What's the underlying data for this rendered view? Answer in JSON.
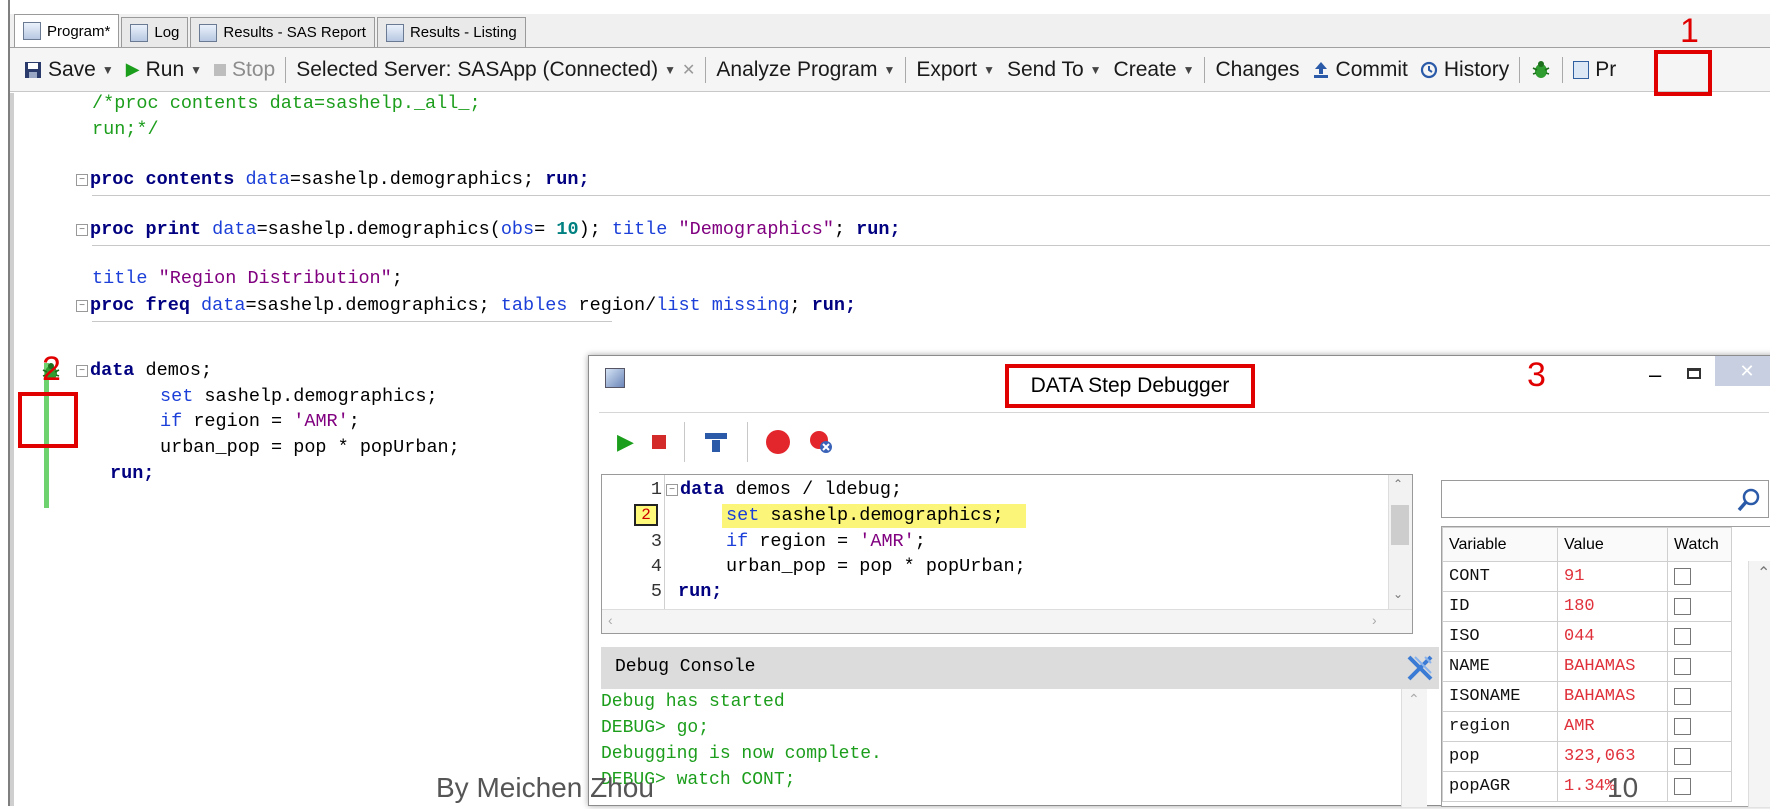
{
  "tabs": [
    {
      "label": "Program*",
      "active": true
    },
    {
      "label": "Log",
      "active": false
    },
    {
      "label": "Results - SAS Report",
      "active": false
    },
    {
      "label": "Results - Listing",
      "active": false
    }
  ],
  "toolbar": {
    "save": "Save",
    "run": "Run",
    "stop": "Stop",
    "server": "Selected Server: SASApp (Connected)",
    "analyze": "Analyze Program",
    "export": "Export",
    "send_to": "Send To",
    "create": "Create",
    "changes": "Changes",
    "commit": "Commit",
    "history": "History",
    "cut_off": "Pr"
  },
  "code": {
    "l1": "/*proc contents data=sashelp._all_;",
    "l2": "run;*/",
    "l3_kw": "proc contents",
    "l3_opt": "data",
    "l3_rest": "=sashelp.demographics; ",
    "l3_run": "run;",
    "l4_kw": "proc print",
    "l4_opt": "data",
    "l4_mid": "=sashelp.demographics(",
    "l4_obs": "obs",
    "l4_eq": "= ",
    "l4_num": "10",
    "l4_close": "); ",
    "l4_title": "title",
    "l4_str": "\"Demographics\"",
    "l4_semi": "; ",
    "l4_run": "run;",
    "l5_title": "title",
    "l5_str": "\"Region Distribution\"",
    "l5_semi": ";",
    "l6_kw": "proc freq",
    "l6_opt": "data",
    "l6_mid": "=sashelp.demographics; ",
    "l6_tables": "tables",
    "l6_rest": " region/",
    "l6_list": "list missing",
    "l6_semi": "; ",
    "l6_run": "run;",
    "l7_kw": "data",
    "l7_rest": " demos;",
    "l8_set": "set",
    "l8_rest": " sashelp.demographics;",
    "l9_if": "if",
    "l9_rest": " region = ",
    "l9_str": "'AMR'",
    "l9_semi": ";",
    "l10": "urban_pop = pop * popUrban;",
    "l11": "run;"
  },
  "annotations": {
    "n1": "1",
    "n2": "2",
    "n3": "3"
  },
  "debugger": {
    "title": "DATA Step Debugger",
    "code": [
      {
        "num": "1",
        "kw": "data",
        "rest": " demos / ldebug;"
      },
      {
        "num": "2",
        "kw": "set",
        "rest": " sashelp.demographics;"
      },
      {
        "num": "3",
        "kw": "if",
        "rest": " region = ",
        "str": "'AMR'",
        "tail": ";"
      },
      {
        "num": "4",
        "kw": "",
        "rest": "urban_pop = pop * popUrban;"
      },
      {
        "num": "5",
        "kw": "run;",
        "rest": ""
      }
    ],
    "console_title": "Debug Console",
    "console_lines": [
      "Debug has started",
      "DEBUG> go;",
      "Debugging is now complete.",
      "DEBUG> watch CONT;"
    ],
    "table_headers": [
      "Variable",
      "Value",
      "Watch"
    ],
    "variables": [
      {
        "name": "CONT",
        "value": "91"
      },
      {
        "name": "ID",
        "value": "180"
      },
      {
        "name": "ISO",
        "value": "044"
      },
      {
        "name": "NAME",
        "value": "BAHAMAS"
      },
      {
        "name": "ISONAME",
        "value": "BAHAMAS"
      },
      {
        "name": "region",
        "value": "AMR"
      },
      {
        "name": "pop",
        "value": "323,063"
      },
      {
        "name": "popAGR",
        "value": "1.34%"
      }
    ]
  },
  "footer": {
    "author": "By Meichen Zhou",
    "page": "10"
  },
  "colors": {
    "annotation_red": "#e00000",
    "comment_green": "#1c9e1c",
    "value_red": "#e0303a"
  }
}
